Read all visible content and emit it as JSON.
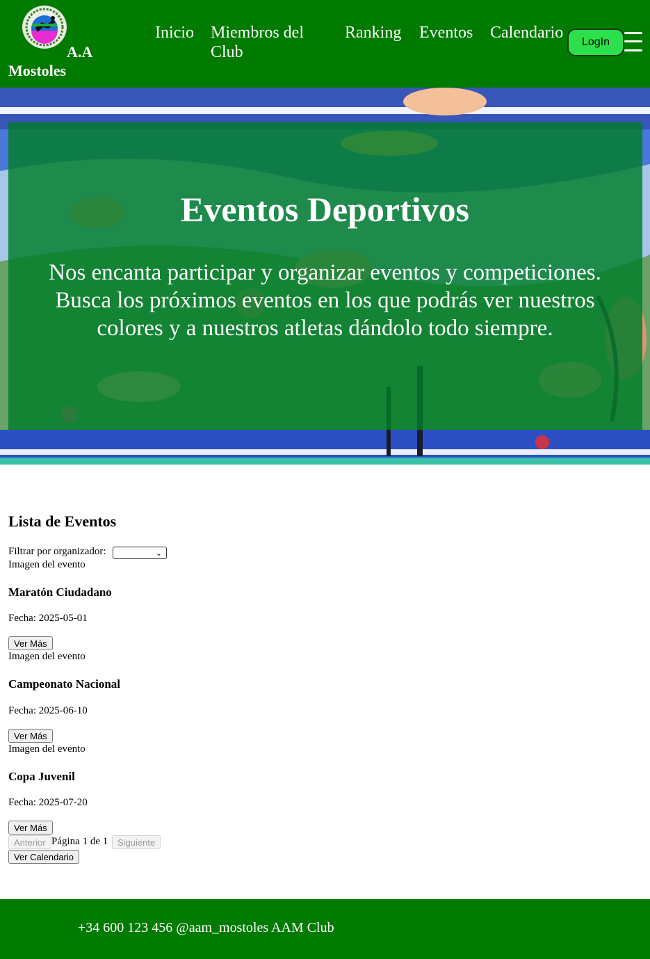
{
  "header": {
    "brand_line1": "A.A",
    "brand_line2": "Mostoles",
    "logo_text": "A.A. MOSTOLES",
    "nav": [
      "Inicio",
      "Miembros del Club",
      "Ranking",
      "Eventos",
      "Calendario"
    ],
    "login_label": "LogIn"
  },
  "hero": {
    "title": "Eventos Deportivos",
    "text": "Nos encanta participar y organizar eventos y competiciones. Busca los próximos eventos en los que podrás ver nuestros colores y a nuestros atletas dándolo todo siempre."
  },
  "events_section": {
    "title": "Lista de Eventos",
    "filter_label": "Filtrar por organizador:",
    "filter_value": "",
    "image_alt": "Imagen del evento",
    "more_label": "Ver Más",
    "events": [
      {
        "name": "Maratón Ciudadano",
        "date": "Fecha: 2025-05-01"
      },
      {
        "name": "Campeonato Nacional",
        "date": "Fecha: 2025-06-10"
      },
      {
        "name": "Copa Juvenil",
        "date": "Fecha: 2025-07-20"
      }
    ],
    "prev_label": "Anterior",
    "page_info": "Página 1 de 1",
    "next_label": "Siguiente",
    "calendar_label": "Ver Calendario"
  },
  "footer": {
    "text": "+34 600 123 456 @aam_mostoles AAM Club"
  },
  "colors": {
    "header_bg": "#007b00",
    "login_bg": "#2be04a",
    "overlay": "#007d28"
  }
}
